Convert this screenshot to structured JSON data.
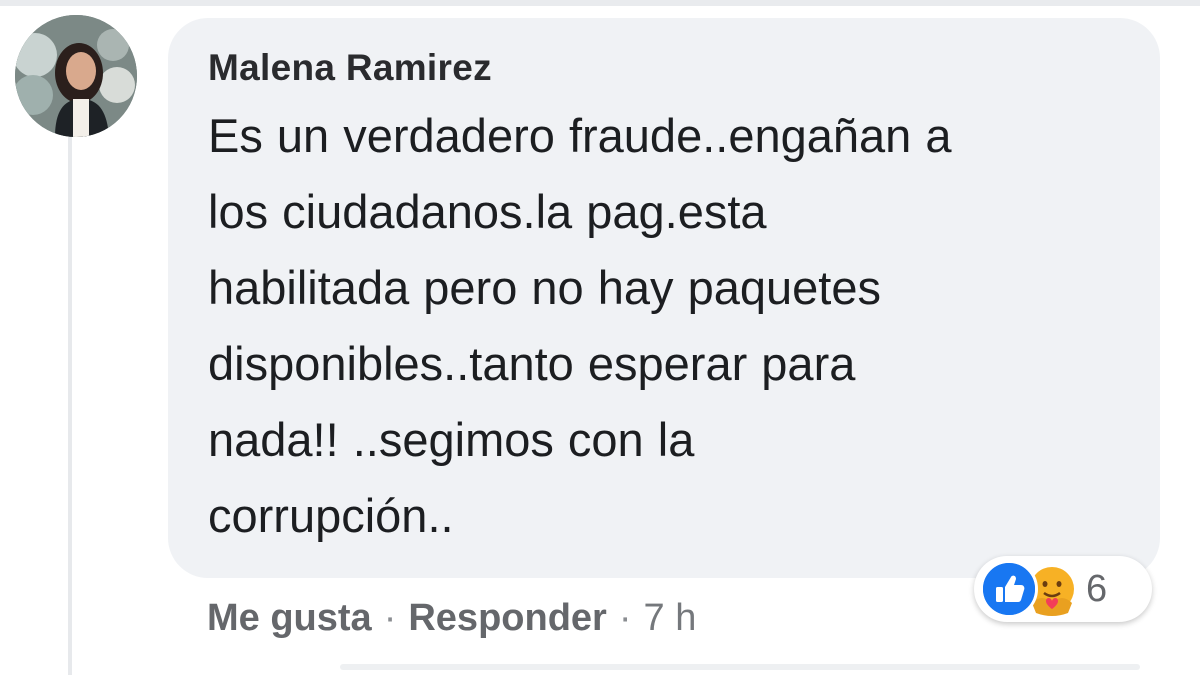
{
  "comment": {
    "author": "Malena Ramirez",
    "text_lines": [
      "Es un verdadero fraude..engañan a",
      "los ciudadanos.la pag.esta",
      "habilitada pero no hay paquetes",
      "disponibles..tanto esperar para",
      "nada!! ..segimos con la",
      "corrupción.."
    ],
    "actions": {
      "like_label": "Me gusta",
      "separator": "·",
      "reply_label": "Responder",
      "time": "7 h"
    },
    "reactions": {
      "icons": [
        "like-icon",
        "care-icon"
      ],
      "count": "6"
    }
  },
  "colors": {
    "bubble": "#f0f2f5",
    "like_blue": "#1877f2",
    "care_yellow": "#f7b125"
  }
}
